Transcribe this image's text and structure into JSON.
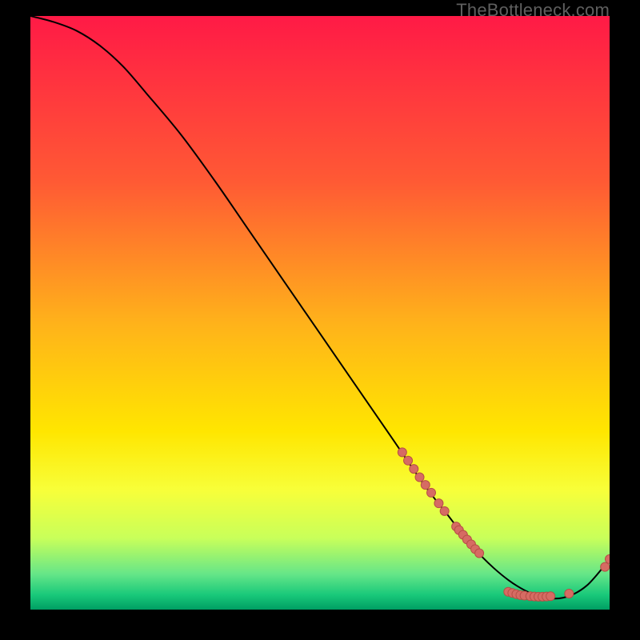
{
  "watermark": "TheBottleneck.com",
  "chart_data": {
    "type": "line",
    "title": "",
    "xlabel": "",
    "ylabel": "",
    "xlim": [
      0,
      100
    ],
    "ylim": [
      0,
      100
    ],
    "grid": false,
    "legend": false,
    "gradient_stops": [
      {
        "offset": 0.0,
        "color": "#ff1a46"
      },
      {
        "offset": 0.28,
        "color": "#ff5a34"
      },
      {
        "offset": 0.52,
        "color": "#ffb31a"
      },
      {
        "offset": 0.7,
        "color": "#ffe600"
      },
      {
        "offset": 0.8,
        "color": "#f7ff3a"
      },
      {
        "offset": 0.88,
        "color": "#c8ff5a"
      },
      {
        "offset": 0.94,
        "color": "#66e688"
      },
      {
        "offset": 0.975,
        "color": "#19c97a"
      },
      {
        "offset": 1.0,
        "color": "#009e63"
      }
    ],
    "series": [
      {
        "name": "bottleneck-curve",
        "x": [
          0,
          4,
          8,
          12,
          16,
          20,
          26,
          32,
          38,
          44,
          50,
          56,
          62,
          68,
          72,
          76,
          80,
          84,
          88,
          92,
          96,
          100
        ],
        "y": [
          100,
          99,
          97.5,
          95,
          91.5,
          87,
          80,
          72,
          63.5,
          55,
          46.5,
          38,
          29.5,
          21,
          16,
          11,
          7,
          4,
          2.2,
          2,
          4,
          8.5
        ]
      }
    ],
    "marker_clusters": [
      {
        "name": "cluster-upper-slope",
        "points": [
          {
            "x": 64.2,
            "y": 26.5
          },
          {
            "x": 65.2,
            "y": 25.1
          },
          {
            "x": 66.2,
            "y": 23.7
          },
          {
            "x": 67.2,
            "y": 22.3
          },
          {
            "x": 68.2,
            "y": 21.0
          },
          {
            "x": 69.2,
            "y": 19.7
          },
          {
            "x": 70.5,
            "y": 17.9
          },
          {
            "x": 71.5,
            "y": 16.6
          }
        ]
      },
      {
        "name": "cluster-lower-slope",
        "points": [
          {
            "x": 73.5,
            "y": 14.0
          },
          {
            "x": 74.0,
            "y": 13.4
          },
          {
            "x": 74.7,
            "y": 12.6
          },
          {
            "x": 75.4,
            "y": 11.8
          },
          {
            "x": 76.1,
            "y": 11.0
          },
          {
            "x": 76.8,
            "y": 10.2
          },
          {
            "x": 77.5,
            "y": 9.5
          }
        ]
      },
      {
        "name": "cluster-valley",
        "points": [
          {
            "x": 82.5,
            "y": 3.0
          },
          {
            "x": 83.2,
            "y": 2.8
          },
          {
            "x": 83.9,
            "y": 2.6
          },
          {
            "x": 84.6,
            "y": 2.45
          },
          {
            "x": 85.3,
            "y": 2.35
          },
          {
            "x": 86.3,
            "y": 2.25
          },
          {
            "x": 87.0,
            "y": 2.2
          },
          {
            "x": 87.7,
            "y": 2.18
          },
          {
            "x": 88.4,
            "y": 2.18
          },
          {
            "x": 89.1,
            "y": 2.2
          },
          {
            "x": 89.8,
            "y": 2.25
          }
        ]
      },
      {
        "name": "cluster-valley-right",
        "points": [
          {
            "x": 93.0,
            "y": 2.7
          }
        ]
      },
      {
        "name": "cluster-tail",
        "points": [
          {
            "x": 99.2,
            "y": 7.2
          },
          {
            "x": 100.0,
            "y": 8.5
          }
        ]
      }
    ],
    "style": {
      "line_color": "#000000",
      "line_width": 2.0,
      "marker_fill": "#d66b63",
      "marker_stroke": "#b74f46",
      "marker_radius": 5.5
    }
  }
}
